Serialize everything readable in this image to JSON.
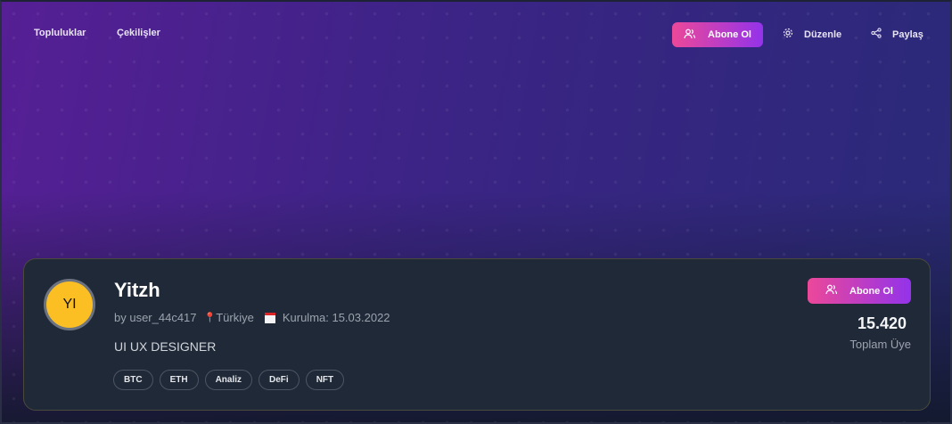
{
  "nav": {
    "items": [
      "Topluluklar",
      "Çekilişler"
    ]
  },
  "header_actions": {
    "subscribe": "Abone Ol",
    "edit": "Düzenle",
    "share": "Paylaş"
  },
  "community": {
    "initials": "YI",
    "name": "Yitzh",
    "owner": "by user_44c417",
    "location": "Türkiye",
    "founded": "Kurulma: 15.03.2022",
    "description": "UI UX DESIGNER",
    "tags": [
      "BTC",
      "ETH",
      "Analiz",
      "DeFi",
      "NFT"
    ],
    "subscribe": "Abone Ol",
    "member_count": "15.420",
    "member_label": "Toplam Üye"
  },
  "colors": {
    "accent_start": "#ec4899",
    "accent_end": "#9333ea",
    "avatar": "#fbbf24",
    "card": "#1f2937"
  }
}
